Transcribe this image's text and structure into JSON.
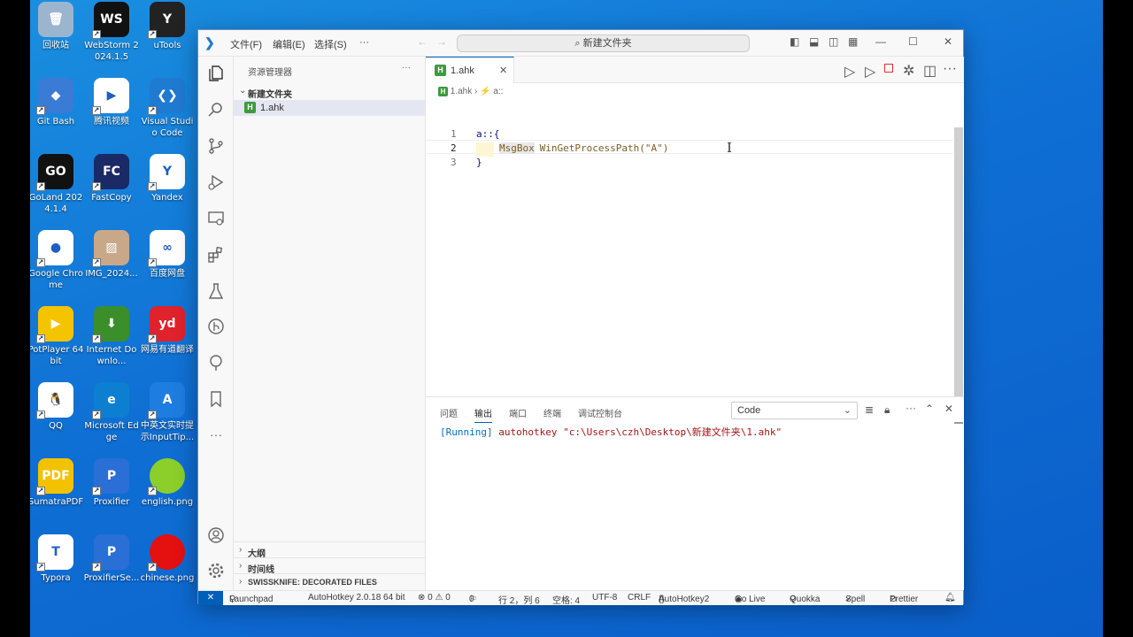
{
  "desktop": {
    "icons": [
      {
        "label": "回收站",
        "glyph": "🗑",
        "color": "#9bb5cf"
      },
      {
        "label": "WebStorm 2024.1.5",
        "glyph": "WS",
        "color": "#111111"
      },
      {
        "label": "uTools",
        "glyph": "Y",
        "color": "#222222"
      },
      {
        "label": "Git Bash",
        "glyph": "◆",
        "color": "#3a7bd5"
      },
      {
        "label": "腾讯视频",
        "glyph": "▶",
        "color": "#ffffff"
      },
      {
        "label": "Visual Studio Code",
        "glyph": "❮❯",
        "color": "#1f7ad1"
      },
      {
        "label": "GoLand 2024.1.4",
        "glyph": "GO",
        "color": "#111111"
      },
      {
        "label": "FastCopy",
        "glyph": "FC",
        "color": "#1a2a66"
      },
      {
        "label": "Yandex",
        "glyph": "Y",
        "color": "#ffffff"
      },
      {
        "label": "Google Chrome",
        "glyph": "●",
        "color": "#ffffff"
      },
      {
        "label": "IMG_2024...",
        "glyph": "▨",
        "color": "#c9a88a"
      },
      {
        "label": "百度网盘",
        "glyph": "∞",
        "color": "#ffffff"
      },
      {
        "label": "PotPlayer 64 bit",
        "glyph": "▶",
        "color": "#f5c400"
      },
      {
        "label": "Internet Downlo...",
        "glyph": "⬇",
        "color": "#3a8f2a"
      },
      {
        "label": "网易有道翻译",
        "glyph": "yd",
        "color": "#e0222c"
      },
      {
        "label": "QQ",
        "glyph": "🐧",
        "color": "#ffffff"
      },
      {
        "label": "Microsoft Edge",
        "glyph": "e",
        "color": "#0c7fd1"
      },
      {
        "label": "中英文实时提示InputTip...",
        "glyph": "A",
        "color": "#1d7de0"
      },
      {
        "label": "SumatraPDF",
        "glyph": "PDF",
        "color": "#f2c200"
      },
      {
        "label": "Proxifier",
        "glyph": "P",
        "color": "#2a6fd6"
      },
      {
        "label": "english.png",
        "glyph": "",
        "color": "#8ccf2a"
      },
      {
        "label": "Typora",
        "glyph": "T",
        "color": "#ffffff"
      },
      {
        "label": "ProxifierSe...",
        "glyph": "P",
        "color": "#2a6fd6"
      },
      {
        "label": "chinese.png",
        "glyph": "",
        "color": "#e51010"
      }
    ]
  },
  "window": {
    "menu": [
      "文件(F)",
      "编辑(E)",
      "选择(S)",
      "···"
    ],
    "search": "新建文件夹"
  },
  "sidebar": {
    "title": "资源管理器",
    "more": "···",
    "folder": "新建文件夹",
    "file": "1.ahk",
    "sections": [
      "大纲",
      "时间线",
      "SWISSKNIFE: DECORATED FILES"
    ]
  },
  "editor": {
    "tab": "1.ahk",
    "breadcrumb": [
      "1.ahk",
      "a::"
    ],
    "lines": [
      {
        "num": "1",
        "text": "a::{"
      },
      {
        "num": "2",
        "kw": "MsgBox",
        "rest": " WinGetProcessPath(\"A\")"
      },
      {
        "num": "3",
        "text": "}"
      }
    ]
  },
  "panel": {
    "tabs": [
      "问题",
      "输出",
      "端口",
      "终端",
      "调试控制台"
    ],
    "active_tab": "输出",
    "dropdown": "Code",
    "running": "[Running]",
    "command": "autohotkey \"c:\\Users\\czh\\Desktop\\新建文件夹\\1.ahk\""
  },
  "status": {
    "remote": "✕",
    "launchpad": "Launchpad",
    "ahk_version": "AutoHotkey 2.0.18 64 bit",
    "problems": "⊗ 0 ⚠ 0",
    "ports": "0",
    "position": "行 2，列 6",
    "spaces": "空格: 4",
    "encoding": "UTF-8",
    "eol": "CRLF",
    "language": "AutoHotkey2",
    "golive": "Go Live",
    "quokka": "Quokka",
    "spell": "Spell",
    "prettier": "Prettier"
  }
}
